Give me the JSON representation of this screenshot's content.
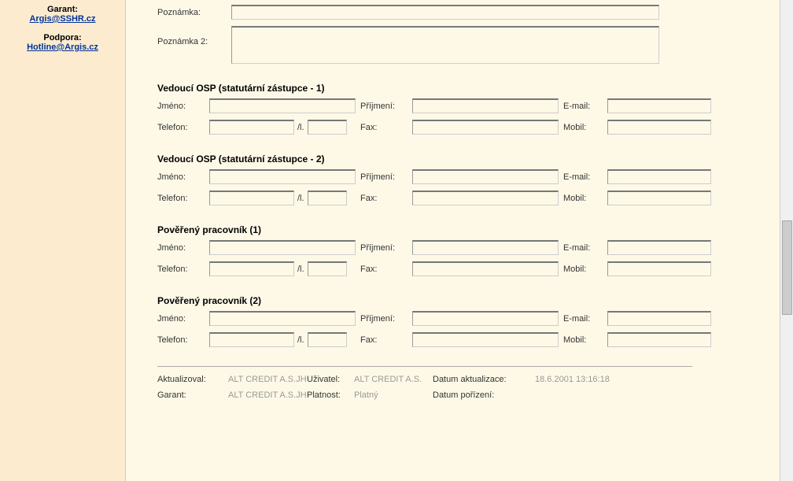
{
  "sidebar": {
    "garant_label": "Garant:",
    "garant_link": "Argis@SSHR.cz",
    "podpora_label": "Podpora:",
    "podpora_link": "Hotline@Argis.cz"
  },
  "notes": {
    "poznamka_label": "Poznámka:",
    "poznamka_value": "",
    "poznamka2_label": "Poznámka 2:",
    "poznamka2_value": ""
  },
  "sections": [
    {
      "title": "Vedoucí OSP (statutární zástupce - 1)"
    },
    {
      "title": "Vedoucí OSP (statutární zástupce - 2)"
    },
    {
      "title": "Pověřený pracovník (1)"
    },
    {
      "title": "Pověřený pracovník (2)"
    }
  ],
  "field_labels": {
    "jmeno": "Jméno:",
    "prijmeni": "Příjmení:",
    "email": "E-mail:",
    "telefon": "Telefon:",
    "tel_sep": "/l.",
    "fax": "Fax:",
    "mobil": "Mobil:"
  },
  "footer": {
    "aktualizoval_label": "Aktualizoval:",
    "aktualizoval_value": "ALT CREDIT A.S.JH",
    "uzivatel_label": "Uživatel:",
    "uzivatel_value": "ALT CREDIT A.S.",
    "datum_akt_label": "Datum aktualizace:",
    "datum_akt_value": "18.6.2001 13:16:18",
    "garant_label": "Garant:",
    "garant_value": "ALT CREDIT A.S.JH",
    "platnost_label": "Platnost:",
    "platnost_value": "Platný",
    "datum_por_label": "Datum pořízení:",
    "datum_por_value": ""
  }
}
